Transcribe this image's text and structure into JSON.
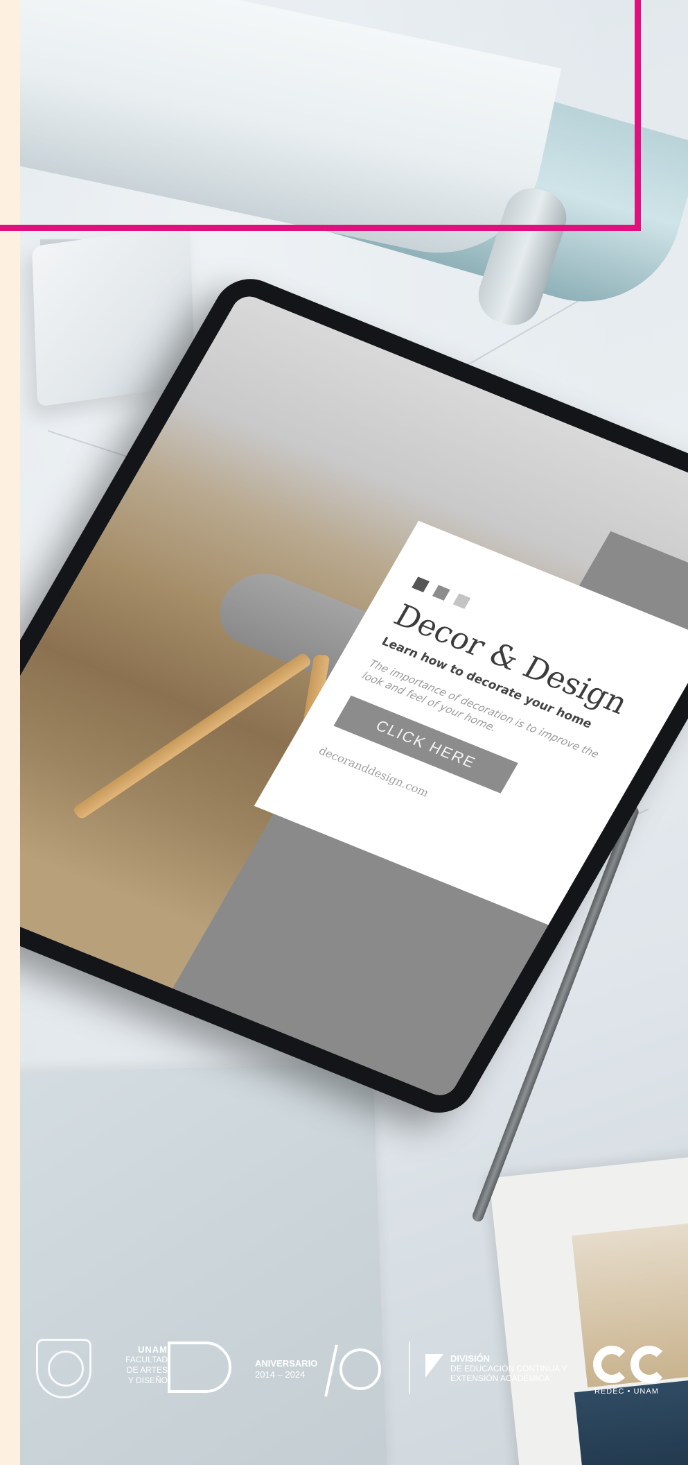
{
  "colors": {
    "accent_frame": "#e0107f",
    "left_strip": "#fdf0e1",
    "card_dot_1": "#555555",
    "card_dot_2": "#8c8c8c",
    "card_dot_3": "#c4c4c4"
  },
  "tablet_screen": {
    "title": "Decor & Design",
    "subtitle": "Learn how to decorate your home",
    "body": "The importance of decoration is to improve the look and feel of your home.",
    "button_label": "CLICK HERE",
    "url": "decoranddesign.com"
  },
  "footer_logos": {
    "fad_unam": "UNAM",
    "fad_lines": "FACULTAD DE ARTES Y DISEÑO",
    "aniversario_title": "ANIVERSARIO",
    "aniversario_years": "2014 – 2024",
    "division_title": "DIVISIÓN",
    "division_lines": "DE EDUCACIÓN CONTINUA Y EXTENSIÓN ACADÉMICA",
    "redec_caption": "REDEC • UNAM"
  }
}
